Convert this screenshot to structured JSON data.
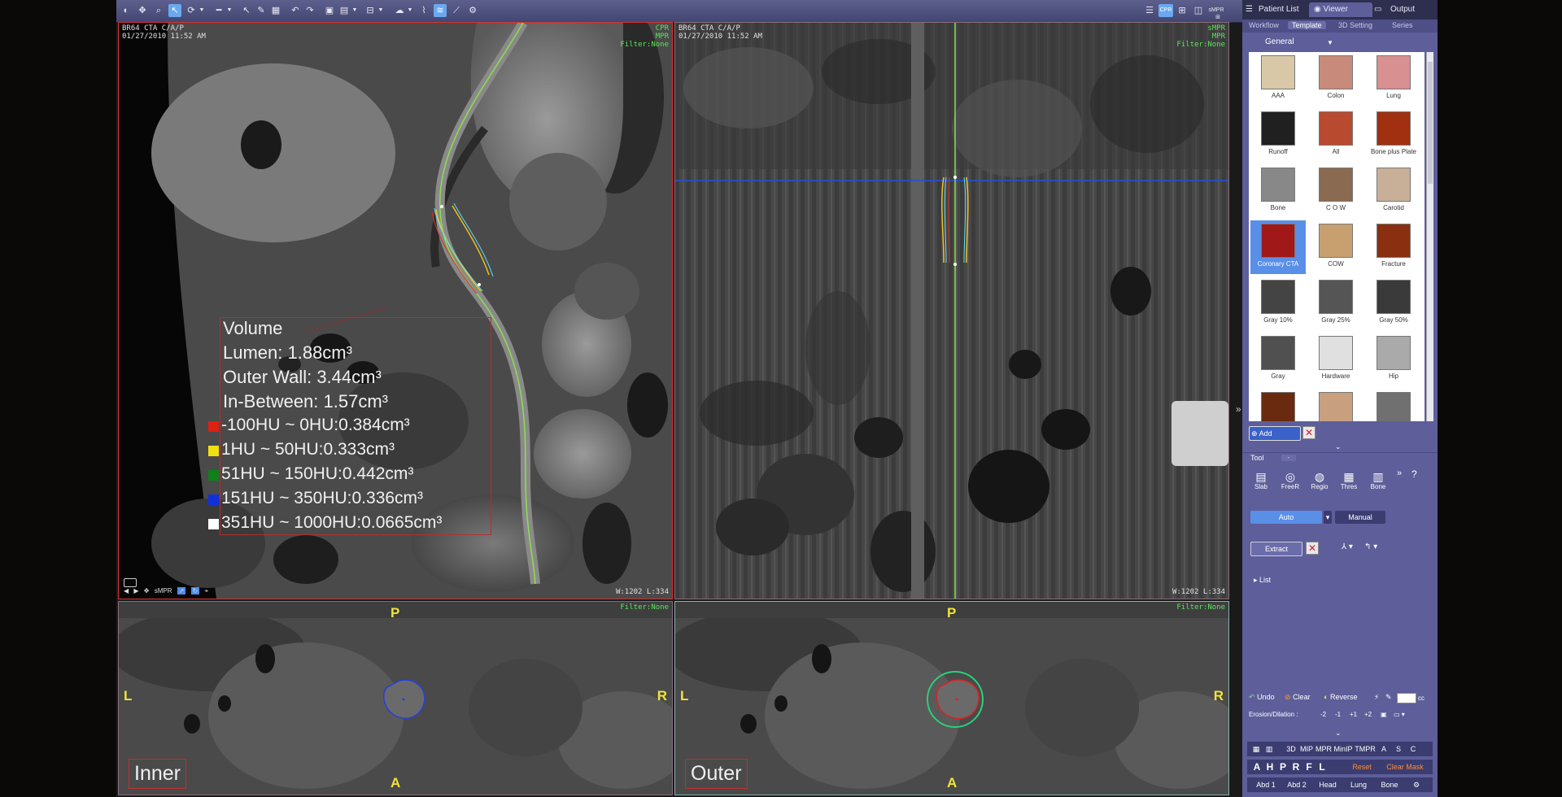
{
  "toolbar": {
    "icons": [
      "window-level",
      "pan",
      "zoom",
      "pointer",
      "rotate",
      "measure",
      "pen",
      "undo",
      "redo",
      "layout",
      "display",
      "color",
      "cine",
      "fly",
      "curved",
      "settings"
    ]
  },
  "view_layout_icons": [
    "list-icon",
    "cpr-icon",
    "cross-icon",
    "box-icon",
    "smpr-icon",
    "layout-icon"
  ],
  "view_layout": {
    "cpr_label": "CPR",
    "smpr_label": "sMPR"
  },
  "nav_tabs": {
    "patient_list": "Patient List",
    "viewer": "Viewer",
    "output": "Output"
  },
  "sub_tabs": {
    "workflow": "Workflow",
    "template": "Template",
    "setting_3d": "3D Setting",
    "series": "Series"
  },
  "template_category": "General",
  "templates": [
    {
      "label": "AAA",
      "color": "#d8c8a8"
    },
    {
      "label": "Colon",
      "color": "#c88a7a"
    },
    {
      "label": "Lung",
      "color": "#d89090"
    },
    {
      "label": "Runoff",
      "color": "#202020"
    },
    {
      "label": "All",
      "color": "#b84a30"
    },
    {
      "label": "Bone plus Plate",
      "color": "#a03010"
    },
    {
      "label": "Bone",
      "color": "#888888"
    },
    {
      "label": "C O W",
      "color": "#8a6a50"
    },
    {
      "label": "Carotid",
      "color": "#c8b098"
    },
    {
      "label": "Coronary CTA",
      "color": "#a01818"
    },
    {
      "label": "COW",
      "color": "#c8a070"
    },
    {
      "label": "Fracture",
      "color": "#8a3010"
    },
    {
      "label": "Gray 10%",
      "color": "#444444"
    },
    {
      "label": "Gray 25%",
      "color": "#555555"
    },
    {
      "label": "Gray 50%",
      "color": "#3a3a3a"
    },
    {
      "label": "Gray",
      "color": "#505050"
    },
    {
      "label": "Hardware",
      "color": "#e0e0e0"
    },
    {
      "label": "Hip",
      "color": "#aaaaaa"
    },
    {
      "label": "",
      "color": "#6a2a10"
    },
    {
      "label": "",
      "color": "#c8a080"
    },
    {
      "label": "",
      "color": "#707070"
    }
  ],
  "panel": {
    "add_label": "Add",
    "tool_header": "Tool",
    "tools": [
      {
        "label": "Slab",
        "icon": "slab-icon"
      },
      {
        "label": "FreeR",
        "icon": "freer-icon"
      },
      {
        "label": "Regio",
        "icon": "region-icon"
      },
      {
        "label": "Thres",
        "icon": "threshold-icon"
      },
      {
        "label": "Bone",
        "icon": "bone-icon"
      }
    ],
    "help": "?",
    "more": "»",
    "mode_auto": "Auto",
    "mode_manual": "Manual",
    "extract_label": "Extract",
    "list_label": "List",
    "undo_label": "Undo",
    "clear_label": "Clear",
    "reverse_label": "Reverse",
    "cc_label": "cc",
    "erosion_label": "Erosion/Dilation :",
    "erosion_values": [
      "-2",
      "-1",
      "+1",
      "+2"
    ],
    "view_buttons": [
      "3D",
      "MIP",
      "MPR",
      "MinIP",
      "TMPR",
      "A",
      "S",
      "C"
    ],
    "orient_buttons": [
      "A",
      "H",
      "P",
      "R",
      "F",
      "L"
    ],
    "reset_label": "Reset",
    "clear_mask_label": "Clear Mask",
    "preset_buttons": [
      "Abd 1",
      "Abd 2",
      "Head",
      "Lung",
      "Bone"
    ]
  },
  "viewports": {
    "cpr": {
      "header_left": [
        "BR64 CTA C/A/P",
        "01/27/2010 11:52 AM"
      ],
      "header_right": [
        "CPR",
        "MPR",
        "Filter:None"
      ],
      "wl": "W:1202 L:334",
      "volume": {
        "title": "Volume",
        "lumen": "Lumen: 1.88cm³",
        "outer_wall": "Outer Wall: 3.44cm³",
        "in_between": "In-Between: 1.57cm³",
        "hu_ranges": [
          {
            "text": "-100HU ~ 0HU:0.384cm³",
            "color": "#e02010"
          },
          {
            "text": "1HU ~ 50HU:0.333cm³",
            "color": "#f0e010"
          },
          {
            "text": "51HU ~ 150HU:0.442cm³",
            "color": "#10801a"
          },
          {
            "text": "151HU ~ 350HU:0.336cm³",
            "color": "#1030e0"
          },
          {
            "text": "351HU ~ 1000HU:0.0665cm³",
            "color": "#ffffff"
          }
        ]
      },
      "mini_tools": [
        "◀",
        "▶",
        "✥",
        "sMPR",
        "↗",
        "↻",
        "⌖"
      ]
    },
    "smpr": {
      "header_left": [
        "BR64 CTA C/A/P",
        "01/27/2010 11:52 AM"
      ],
      "header_right": [
        "sMPR",
        "MPR",
        "Filter:None"
      ],
      "wl": "W:1202 L:334"
    },
    "inner": {
      "filter": "Filter:None",
      "label": "Inner",
      "orient": {
        "top": "P",
        "bottom": "A",
        "left": "L",
        "right": "R"
      }
    },
    "outer": {
      "filter": "Filter:None",
      "label": "Outer",
      "orient": {
        "top": "P",
        "bottom": "A",
        "left": "L",
        "right": "R"
      }
    }
  },
  "colors": {
    "vessel_centerline": "#8be04a",
    "accent": "#5a8fe8",
    "panel_bg": "#5d5e9a"
  }
}
